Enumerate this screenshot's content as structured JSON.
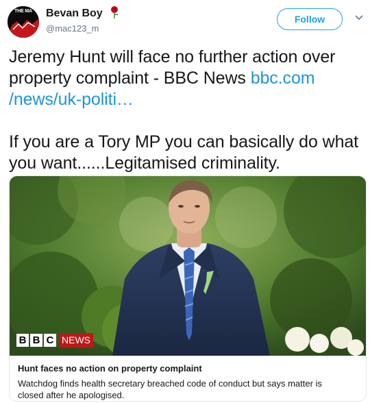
{
  "user": {
    "avatar_text": "THE MA",
    "display_name": "Bevan Boy",
    "handle": "@mac123_m",
    "badge_icon": "rose-icon"
  },
  "follow_label": "Follow",
  "tweet": {
    "line1_text": "Jeremy Hunt will face no further action over property complaint - BBC News ",
    "link_text": "bbc.com /news/uk-politi…",
    "line2_text": "If you are a Tory MP you can basically do what you want......Legitamised criminality."
  },
  "card": {
    "logo_letters": [
      "B",
      "B",
      "C"
    ],
    "logo_word": "NEWS",
    "title": "Hunt faces no action on property complaint",
    "description": "Watchdog finds health secretary breached code of conduct but says matter is closed after he apologised."
  },
  "colors": {
    "link": "#1b95e0",
    "follow": "#1da1f2",
    "bbc_red": "#bb1919"
  }
}
